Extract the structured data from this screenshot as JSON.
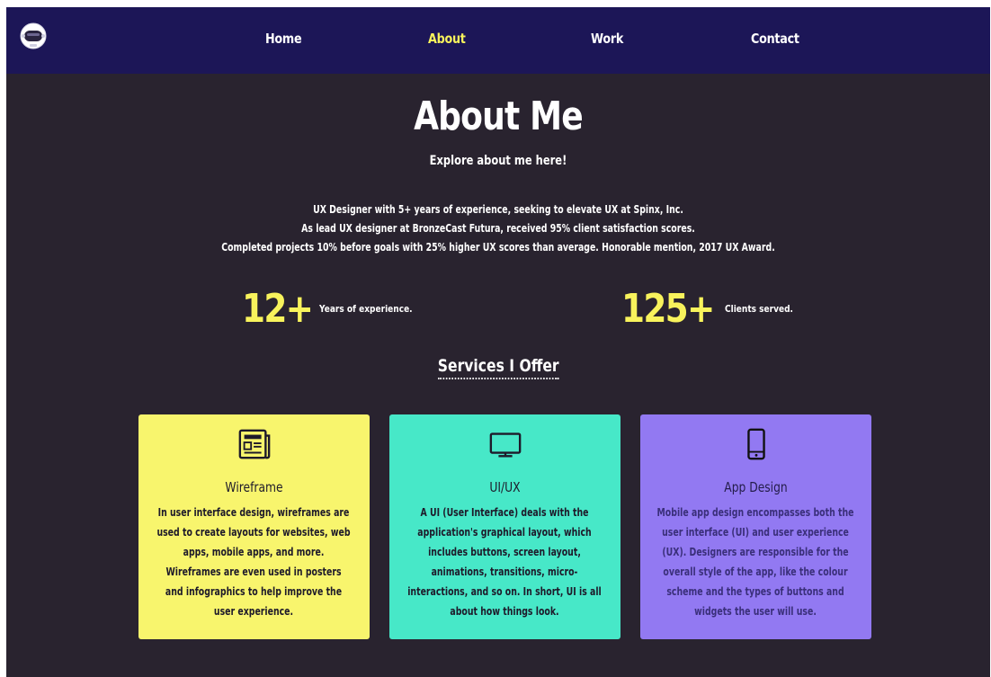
{
  "nav": {
    "logo_icon": "astronaut-helmet-icon",
    "links": [
      {
        "label": "Home",
        "active": false
      },
      {
        "label": "About",
        "active": true
      },
      {
        "label": "Work",
        "active": false
      },
      {
        "label": "Contact",
        "active": false
      }
    ],
    "active_color": "#f8f35c",
    "background": "#1c1657"
  },
  "hero": {
    "title": "About Me",
    "subtitle": "Explore about me here!",
    "bio": [
      "UX Designer with 5+ years of experience, seeking to elevate UX at Spinx, Inc.",
      "As lead UX designer at BronzeCast Futura, received 95% client satisfaction scores.",
      "Completed projects 10% before goals with 25% higher UX scores than average. Honorable mention, 2017 UX Award."
    ]
  },
  "stats": [
    {
      "number": "12+",
      "label": "Years of experience."
    },
    {
      "number": "125+",
      "label": "Clients served."
    }
  ],
  "services": {
    "heading": "Services I Offer",
    "cards": [
      {
        "icon": "newspaper-icon",
        "title": "Wireframe",
        "color": "#f8f56d",
        "lines": [
          "In user interface design, wireframes are",
          "used to create layouts for websites, web",
          "apps, mobile apps, and more.",
          "Wireframes are even used in posters",
          "and infographics to help improve the",
          "user experience."
        ]
      },
      {
        "icon": "monitor-icon",
        "title": "UI/UX",
        "color": "#47e8c8",
        "lines": [
          "A UI (User Interface) deals with the",
          "application's graphical layout, which",
          "includes buttons, screen layout,",
          "animations, transitions, micro-",
          "interactions, and so on. In short, UI is all",
          "about how things look."
        ]
      },
      {
        "icon": "smartphone-icon",
        "title": "App Design",
        "color": "#9279f2",
        "lines": [
          "Mobile app design encompasses both the",
          "user interface (UI) and user experience",
          "(UX). Designers are responsible for the",
          "overall style of the app, like the colour",
          "scheme and the types of buttons and",
          "widgets the user will use."
        ]
      }
    ]
  },
  "theme": {
    "page_background": "#29232f",
    "accent": "#f8f35c"
  }
}
